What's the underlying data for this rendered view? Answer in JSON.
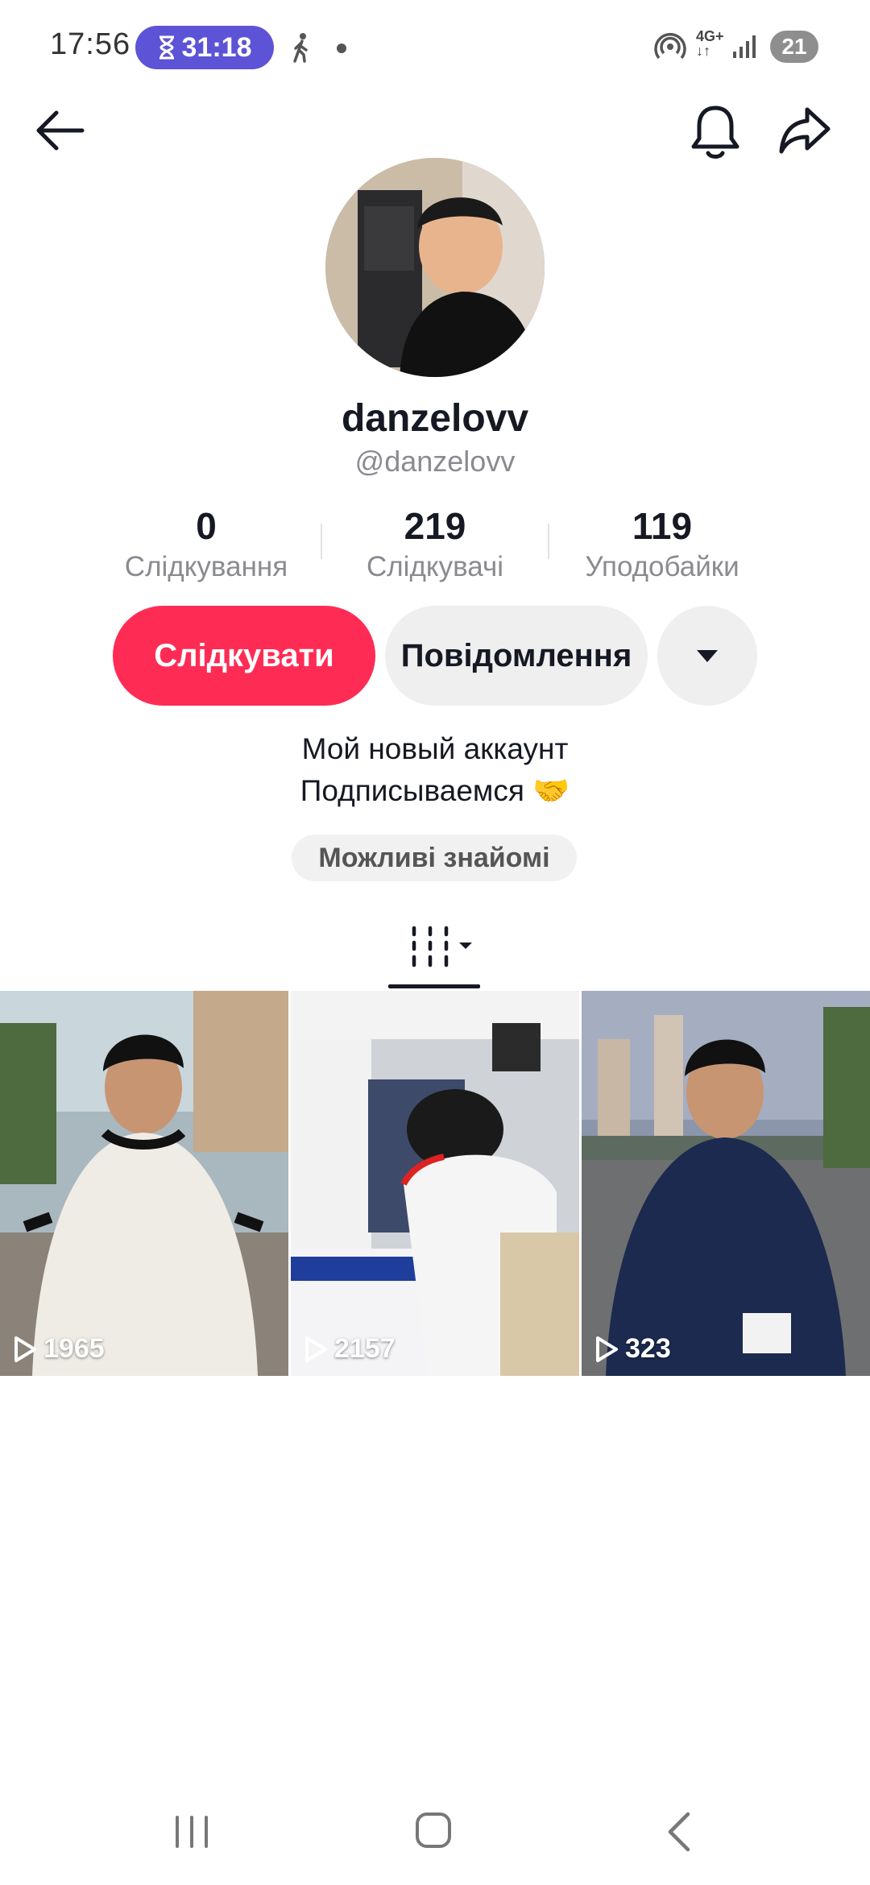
{
  "status_bar": {
    "time": "17:56",
    "timer": "31:18",
    "network": "4G+",
    "battery": "21"
  },
  "profile": {
    "display_name": "danzelovv",
    "handle": "@danzelovv",
    "stats": [
      {
        "value": "0",
        "label": "Слідкування"
      },
      {
        "value": "219",
        "label": "Слідкувачі"
      },
      {
        "value": "119",
        "label": "Уподобайки"
      }
    ],
    "follow_label": "Слідкувати",
    "message_label": "Повідомлення",
    "bio_line1": "Мой новый аккаунт",
    "bio_line2": "Подписываемся 🤝",
    "chip_label": "Можливі знайомі"
  },
  "videos": [
    {
      "views": "1965"
    },
    {
      "views": "2157"
    },
    {
      "views": "323"
    }
  ],
  "colors": {
    "accent": "#fe2c55",
    "timer_pill": "#5d53d6"
  }
}
